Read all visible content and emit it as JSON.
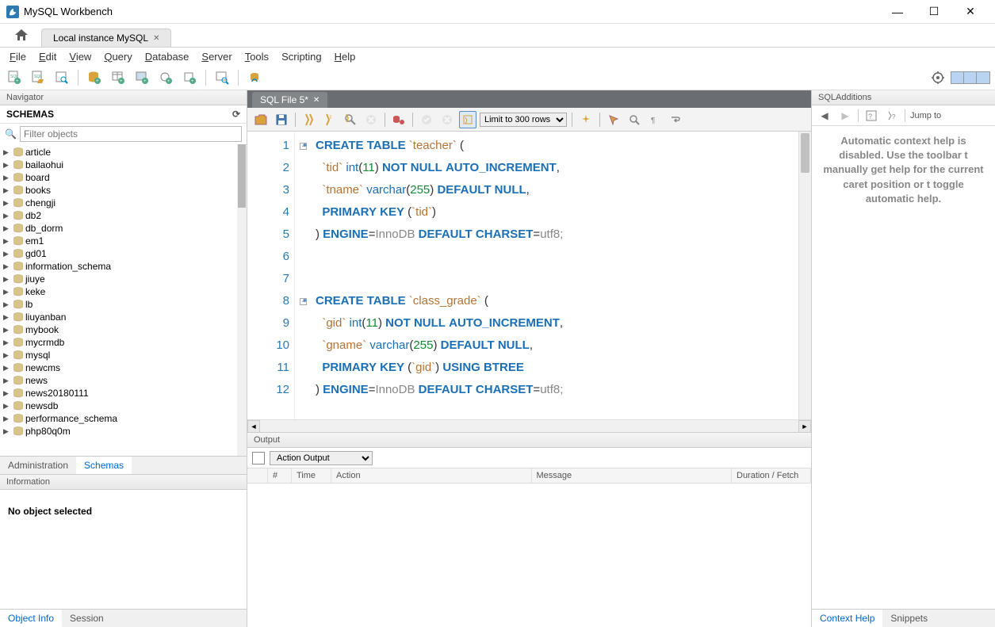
{
  "app": {
    "title": "MySQL Workbench"
  },
  "conn_tab": {
    "label": "Local instance MySQL"
  },
  "menu": {
    "file": "File",
    "edit": "Edit",
    "view": "View",
    "query": "Query",
    "database": "Database",
    "server": "Server",
    "tools": "Tools",
    "scripting": "Scripting",
    "help": "Help"
  },
  "navigator": {
    "title": "Navigator",
    "schemas_label": "SCHEMAS",
    "filter_placeholder": "Filter objects",
    "items": [
      {
        "name": "article"
      },
      {
        "name": "bailaohui"
      },
      {
        "name": "board"
      },
      {
        "name": "books"
      },
      {
        "name": "chengji"
      },
      {
        "name": "db2"
      },
      {
        "name": "db_dorm"
      },
      {
        "name": "em1"
      },
      {
        "name": "gd01"
      },
      {
        "name": "information_schema"
      },
      {
        "name": "jiuye"
      },
      {
        "name": "keke"
      },
      {
        "name": "lb"
      },
      {
        "name": "liuyanban"
      },
      {
        "name": "mybook"
      },
      {
        "name": "mycrmdb"
      },
      {
        "name": "mysql"
      },
      {
        "name": "newcms"
      },
      {
        "name": "news"
      },
      {
        "name": "news20180111"
      },
      {
        "name": "newsdb"
      },
      {
        "name": "performance_schema"
      },
      {
        "name": "php80q0m"
      }
    ],
    "tabs": {
      "admin": "Administration",
      "schemas": "Schemas"
    },
    "info_header": "Information",
    "info_body": "No object selected",
    "bottom_tabs": {
      "objinfo": "Object Info",
      "session": "Session"
    }
  },
  "editor": {
    "file_tab": "SQL File 5*",
    "limit_label": "Limit to 300 rows",
    "lines": [
      {
        "n": 1,
        "dot": true,
        "fold": true,
        "tokens": [
          [
            "kw",
            "CREATE"
          ],
          [
            "sp",
            " "
          ],
          [
            "kw",
            "TABLE"
          ],
          [
            "sp",
            " "
          ],
          [
            "ident",
            "`teacher`"
          ],
          [
            "sp",
            " "
          ],
          [
            "punct",
            "("
          ]
        ]
      },
      {
        "n": 2,
        "tokens": [
          [
            "sp",
            "  "
          ],
          [
            "ident",
            "`tid`"
          ],
          [
            "sp",
            " "
          ],
          [
            "kw2",
            "int"
          ],
          [
            "punct",
            "("
          ],
          [
            "num",
            "11"
          ],
          [
            "punct",
            ")"
          ],
          [
            "sp",
            " "
          ],
          [
            "kw",
            "NOT"
          ],
          [
            "sp",
            " "
          ],
          [
            "kw",
            "NULL"
          ],
          [
            "sp",
            " "
          ],
          [
            "kw",
            "AUTO_INCREMENT"
          ],
          [
            "punct",
            ","
          ]
        ]
      },
      {
        "n": 3,
        "tokens": [
          [
            "sp",
            "  "
          ],
          [
            "ident",
            "`tname`"
          ],
          [
            "sp",
            " "
          ],
          [
            "kw2",
            "varchar"
          ],
          [
            "punct",
            "("
          ],
          [
            "num",
            "255"
          ],
          [
            "punct",
            ")"
          ],
          [
            "sp",
            " "
          ],
          [
            "kw",
            "DEFAULT"
          ],
          [
            "sp",
            " "
          ],
          [
            "kw",
            "NULL"
          ],
          [
            "punct",
            ","
          ]
        ]
      },
      {
        "n": 4,
        "tokens": [
          [
            "sp",
            "  "
          ],
          [
            "kw",
            "PRIMARY"
          ],
          [
            "sp",
            " "
          ],
          [
            "kw",
            "KEY"
          ],
          [
            "sp",
            " "
          ],
          [
            "punct",
            "("
          ],
          [
            "ident",
            "`tid`"
          ],
          [
            "punct",
            ")"
          ]
        ]
      },
      {
        "n": 5,
        "tokens": [
          [
            "punct",
            ")"
          ],
          [
            "sp",
            " "
          ],
          [
            "kw",
            "ENGINE"
          ],
          [
            "punct",
            "="
          ],
          [
            "txt",
            "InnoDB"
          ],
          [
            "sp",
            " "
          ],
          [
            "kw",
            "DEFAULT"
          ],
          [
            "sp",
            " "
          ],
          [
            "kw",
            "CHARSET"
          ],
          [
            "punct",
            "="
          ],
          [
            "txt",
            "utf8;"
          ]
        ]
      },
      {
        "n": 6,
        "tokens": []
      },
      {
        "n": 7,
        "tokens": []
      },
      {
        "n": 8,
        "dot": true,
        "fold": true,
        "tokens": [
          [
            "kw",
            "CREATE"
          ],
          [
            "sp",
            " "
          ],
          [
            "kw",
            "TABLE"
          ],
          [
            "sp",
            " "
          ],
          [
            "ident",
            "`class_grade`"
          ],
          [
            "sp",
            " "
          ],
          [
            "punct",
            "("
          ]
        ]
      },
      {
        "n": 9,
        "tokens": [
          [
            "sp",
            "  "
          ],
          [
            "ident",
            "`gid`"
          ],
          [
            "sp",
            " "
          ],
          [
            "kw2",
            "int"
          ],
          [
            "punct",
            "("
          ],
          [
            "num",
            "11"
          ],
          [
            "punct",
            ")"
          ],
          [
            "sp",
            " "
          ],
          [
            "kw",
            "NOT"
          ],
          [
            "sp",
            " "
          ],
          [
            "kw",
            "NULL"
          ],
          [
            "sp",
            " "
          ],
          [
            "kw",
            "AUTO_INCREMENT"
          ],
          [
            "punct",
            ","
          ]
        ]
      },
      {
        "n": 10,
        "tokens": [
          [
            "sp",
            "  "
          ],
          [
            "ident",
            "`gname`"
          ],
          [
            "sp",
            " "
          ],
          [
            "kw2",
            "varchar"
          ],
          [
            "punct",
            "("
          ],
          [
            "num",
            "255"
          ],
          [
            "punct",
            ")"
          ],
          [
            "sp",
            " "
          ],
          [
            "kw",
            "DEFAULT"
          ],
          [
            "sp",
            " "
          ],
          [
            "kw",
            "NULL"
          ],
          [
            "punct",
            ","
          ]
        ]
      },
      {
        "n": 11,
        "tokens": [
          [
            "sp",
            "  "
          ],
          [
            "kw",
            "PRIMARY"
          ],
          [
            "sp",
            " "
          ],
          [
            "kw",
            "KEY"
          ],
          [
            "sp",
            " "
          ],
          [
            "punct",
            "("
          ],
          [
            "ident",
            "`gid`"
          ],
          [
            "punct",
            ")"
          ],
          [
            "sp",
            " "
          ],
          [
            "kw",
            "USING"
          ],
          [
            "sp",
            " "
          ],
          [
            "kw",
            "BTREE"
          ]
        ]
      },
      {
        "n": 12,
        "tokens": [
          [
            "punct",
            ")"
          ],
          [
            "sp",
            " "
          ],
          [
            "kw",
            "ENGINE"
          ],
          [
            "punct",
            "="
          ],
          [
            "txt",
            "InnoDB"
          ],
          [
            "sp",
            " "
          ],
          [
            "kw",
            "DEFAULT"
          ],
          [
            "sp",
            " "
          ],
          [
            "kw",
            "CHARSET"
          ],
          [
            "punct",
            "="
          ],
          [
            "txt",
            "utf8;"
          ]
        ]
      }
    ]
  },
  "output": {
    "header": "Output",
    "select": "Action Output",
    "cols": {
      "hash": "#",
      "time": "Time",
      "action": "Action",
      "message": "Message",
      "duration": "Duration / Fetch"
    }
  },
  "rightbar": {
    "header": "SQLAdditions",
    "jump": "Jump to",
    "body": "Automatic context help is disabled. Use the toolbar t  manually get help for the current caret position or t  toggle automatic help.",
    "tabs": {
      "ctx": "Context Help",
      "snip": "Snippets"
    }
  }
}
